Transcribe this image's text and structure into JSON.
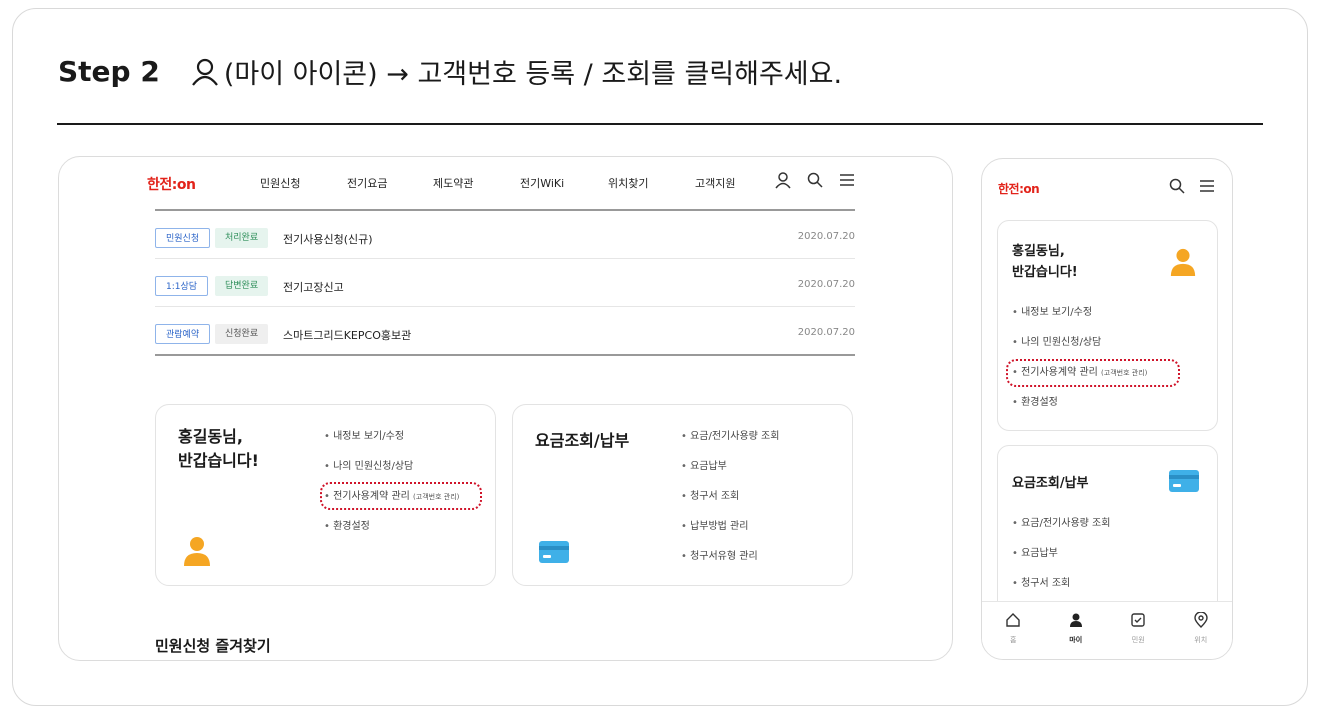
{
  "step": {
    "label": "Step 2",
    "instruction": "(마이 아이콘) → 고객번호 등록 / 조회를 클릭해주세요."
  },
  "brand": {
    "logo": "한전:on",
    "accent": "#e2231a",
    "highlight": "#d0142a"
  },
  "desktop": {
    "nav": [
      "민원신청",
      "전기요금",
      "제도약관",
      "전기WiKi",
      "위치찾기",
      "고객지원"
    ],
    "nav_icons": [
      "user-icon",
      "search-icon",
      "menu-icon"
    ],
    "rows": [
      {
        "badge1": "민원신청",
        "badge2": "처리완료",
        "title": "전기사용신청(신규)",
        "date": "2020.07.20"
      },
      {
        "badge1": "1:1상담",
        "badge2": "답변완료",
        "title": "전기고장신고",
        "date": "2020.07.20"
      },
      {
        "badge1": "관람예약",
        "badge2": "신청완료",
        "title": "스마트그리드KEPCO홍보관",
        "date": "2020.07.20"
      }
    ],
    "greeting_line1": "홍길동님,",
    "greeting_line2": "반갑습니다!",
    "my_links": [
      "내정보 보기/수정",
      "나의 민원신청/상담",
      "전기사용계약 관리",
      "환경설정"
    ],
    "my_link_sub": "(고객번호 관리)",
    "bill_title": "요금조회/납부",
    "bill_links": [
      "요금/전기사용량 조회",
      "요금납부",
      "청구서 조회",
      "납부방법 관리",
      "청구서유형 관리"
    ],
    "favorites_title": "민원신청 즐겨찾기"
  },
  "mobile": {
    "greeting_line1": "홍길동님,",
    "greeting_line2": "반갑습니다!",
    "my_links": [
      "내정보 보기/수정",
      "나의 민원신청/상담",
      "전기사용계약 관리",
      "환경설정"
    ],
    "my_link_sub": "(고객번호 관리)",
    "bill_title": "요금조회/납부",
    "bill_links": [
      "요금/전기사용량 조회",
      "요금납부",
      "청구서 조회"
    ],
    "tabs": [
      "홈",
      "마이",
      "민원",
      "위치"
    ]
  }
}
